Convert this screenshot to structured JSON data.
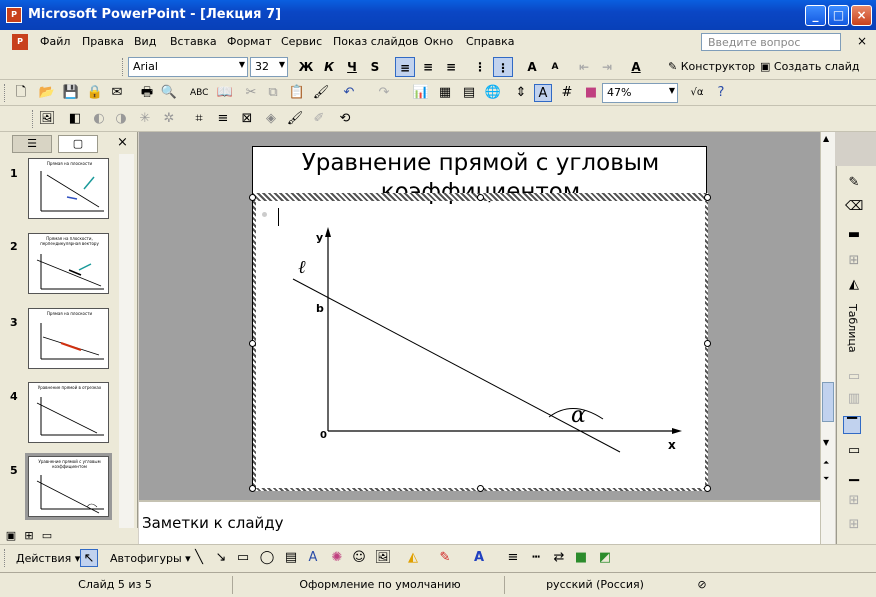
{
  "window": {
    "title": "Microsoft PowerPoint - [Лекция 7]",
    "app_icon": "powerpoint-icon",
    "buttons": [
      "minimize",
      "maximize",
      "close"
    ]
  },
  "menu": {
    "items": [
      "Файл",
      "Правка",
      "Вид",
      "Вставка",
      "Формат",
      "Сервис",
      "Показ слайдов",
      "Окно",
      "Справка"
    ],
    "ask_placeholder": "Введите вопрос"
  },
  "formatting": {
    "font": "Arial",
    "size": "32",
    "bold": "Ж",
    "italic": "К",
    "underline": "Ч",
    "shadow": "S",
    "grow": "A",
    "shrink": "A",
    "font_color": "A",
    "designer": "Конструктор",
    "new_slide": "Создать слайд"
  },
  "standard": {
    "zoom": "47%"
  },
  "sidebar": {
    "tabs": [
      "outline",
      "slides"
    ],
    "slides": [
      {
        "num": "1",
        "title": "Прямая на плоскости"
      },
      {
        "num": "2",
        "title": "Прямая на плоскости, перпендикулярная вектору"
      },
      {
        "num": "3",
        "title": "Прямая на плоскости"
      },
      {
        "num": "4",
        "title": "Уравнение прямой в отрезках"
      },
      {
        "num": "5",
        "title": "Уравнение прямой с угловым коэффициентом"
      }
    ]
  },
  "slide": {
    "title_line1": "Уравнение прямой с угловым",
    "title_line2": "коэффициентом",
    "labels": {
      "y": "y",
      "x": "x",
      "origin": "0",
      "b": "b",
      "line": "ℓ",
      "alpha": "α"
    }
  },
  "notes": {
    "placeholder": "Заметки к слайду"
  },
  "task_pane": {
    "label": "Таблица"
  },
  "drawing": {
    "actions": "Действия",
    "autoshapes": "Автофигуры"
  },
  "status": {
    "slide": "Слайд 5 из 5",
    "design": "Оформление по умолчанию",
    "language": "русский (Россия)"
  },
  "colors": {
    "titlebar": "#0a46c4",
    "chrome": "#ece9d8",
    "workspace": "#a0a0a0"
  }
}
